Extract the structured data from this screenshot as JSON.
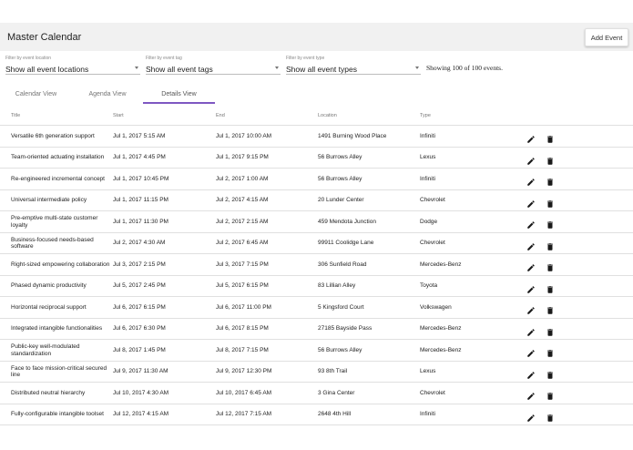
{
  "header": {
    "title": "Master Calendar",
    "add_event_label": "Add Event"
  },
  "filters": [
    {
      "label": "Filter by event location",
      "value": "Show all event locations"
    },
    {
      "label": "Filter by event tag",
      "value": "Show all event tags"
    },
    {
      "label": "Filter by event type",
      "value": "Show all event types"
    }
  ],
  "count_text": "Showing 100 of 100 events.",
  "tabs": [
    {
      "label": "Calendar View",
      "active": false
    },
    {
      "label": "Agenda View",
      "active": false
    },
    {
      "label": "Details View",
      "active": true
    }
  ],
  "colors": {
    "accent": "#7e57c2",
    "header_bg": "#f1f1f1",
    "icon": "#1a1a1a"
  },
  "icons": {
    "edit": "pencil-icon",
    "delete": "trash-icon"
  },
  "table": {
    "columns": [
      "Title",
      "Start",
      "End",
      "Location",
      "Type"
    ],
    "rows": [
      [
        "Versatile 6th generation support",
        "Jul 1, 2017 5:15 AM",
        "Jul 1, 2017 10:00 AM",
        "1491 Burning Wood Place",
        "Infiniti"
      ],
      [
        "Team-oriented actuating installation",
        "Jul 1, 2017 4:45 PM",
        "Jul 1, 2017 9:15 PM",
        "56 Burrows Alley",
        "Lexus"
      ],
      [
        "Re-engineered incremental concept",
        "Jul 1, 2017 10:45 PM",
        "Jul 2, 2017 1:00 AM",
        "56 Burrows Alley",
        "Infiniti"
      ],
      [
        "Universal intermediate policy",
        "Jul 1, 2017 11:15 PM",
        "Jul 2, 2017 4:15 AM",
        "20 Lunder Center",
        "Chevrolet"
      ],
      [
        "Pre-emptive multi-state customer loyalty",
        "Jul 1, 2017 11:30 PM",
        "Jul 2, 2017 2:15 AM",
        "459 Mendota Junction",
        "Dodge"
      ],
      [
        "Business-focused needs-based software",
        "Jul 2, 2017 4:30 AM",
        "Jul 2, 2017 6:45 AM",
        "99911 Coolidge Lane",
        "Chevrolet"
      ],
      [
        "Right-sized empowering collaboration",
        "Jul 3, 2017 2:15 PM",
        "Jul 3, 2017 7:15 PM",
        "306 Sunfield Road",
        "Mercedes-Benz"
      ],
      [
        "Phased dynamic productivity",
        "Jul 5, 2017 2:45 PM",
        "Jul 5, 2017 6:15 PM",
        "83 Lillian Alley",
        "Toyota"
      ],
      [
        "Horizontal reciprocal support",
        "Jul 6, 2017 6:15 PM",
        "Jul 6, 2017 11:00 PM",
        "5 Kingsford Court",
        "Volkswagen"
      ],
      [
        "Integrated intangible functionalities",
        "Jul 6, 2017 6:30 PM",
        "Jul 6, 2017 8:15 PM",
        "27185 Bayside Pass",
        "Mercedes-Benz"
      ],
      [
        "Public-key well-modulated standardization",
        "Jul 8, 2017 1:45 PM",
        "Jul 8, 2017 7:15 PM",
        "56 Burrows Alley",
        "Mercedes-Benz"
      ],
      [
        "Face to face mission-critical secured line",
        "Jul 9, 2017 11:30 AM",
        "Jul 9, 2017 12:30 PM",
        "93 8th Trail",
        "Lexus"
      ],
      [
        "Distributed neutral hierarchy",
        "Jul 10, 2017 4:30 AM",
        "Jul 10, 2017 6:45 AM",
        "3 Gina Center",
        "Chevrolet"
      ],
      [
        "Fully-configurable intangible toolset",
        "Jul 12, 2017 4:15 AM",
        "Jul 12, 2017 7:15 AM",
        "2648 4th Hill",
        "Infiniti"
      ]
    ]
  }
}
